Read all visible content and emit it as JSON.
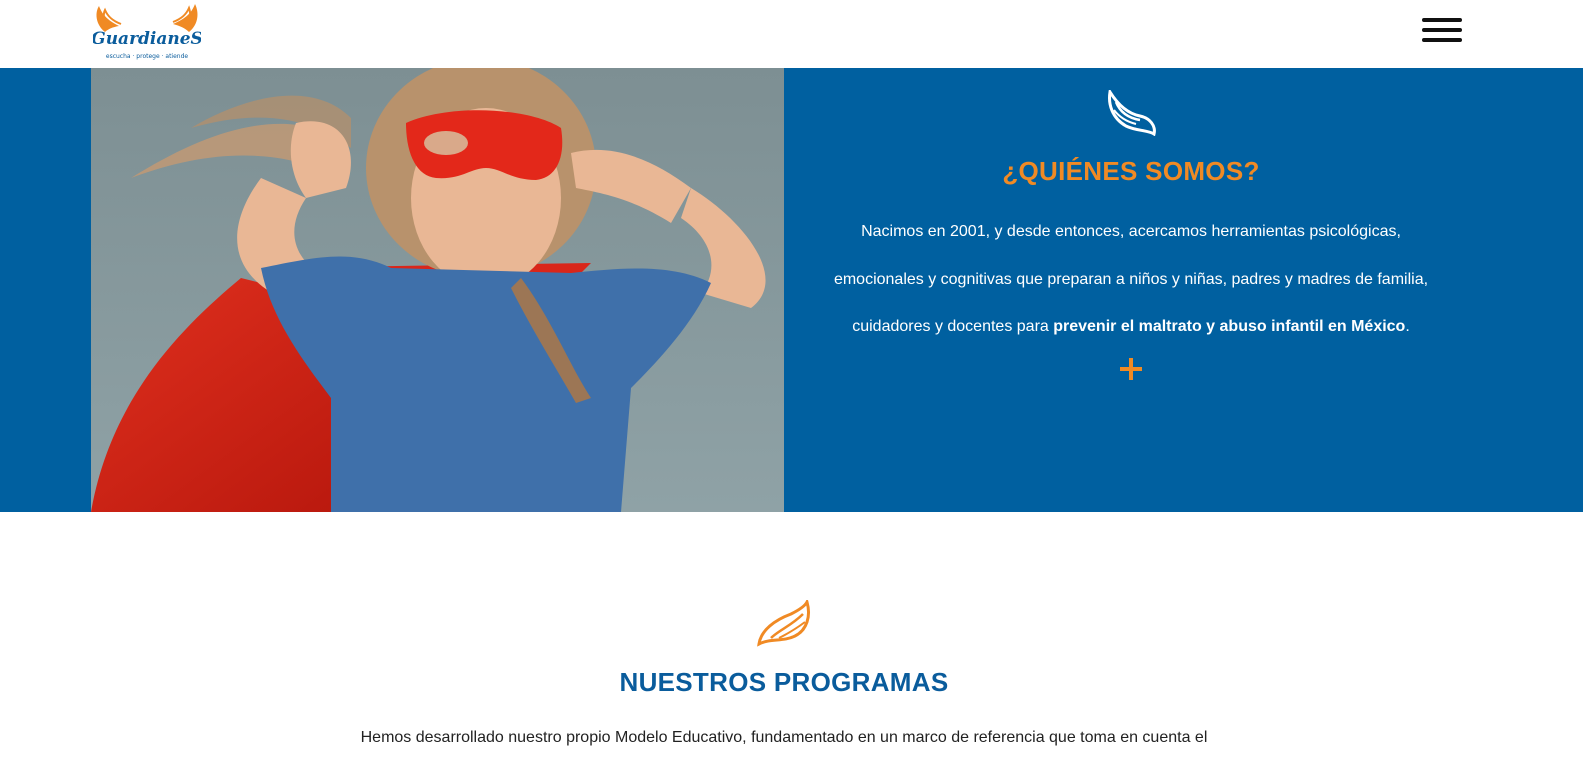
{
  "header": {
    "logo_text": "GuardianeS",
    "logo_tagline": "escucha · protege · atiende",
    "menu_icon": "hamburger-menu-icon"
  },
  "about": {
    "icon": "wing-icon",
    "title": "¿QUIÉNES SOMOS?",
    "text_start": "Nacimos en 2001, y desde entonces, acercamos herramientas psicológicas, emocionales y cognitivas que preparan a niños y niñas, padres y madres de familia, cuidadores y docentes para ",
    "text_bold": "prevenir el maltrato y abuso infantil en México",
    "text_end": ".",
    "more_symbol": "+"
  },
  "programs": {
    "icon": "wing-icon",
    "title": "NUESTROS PROGRAMAS",
    "text": "Hemos desarrollado nuestro propio Modelo Educativo, fundamentado en un marco de referencia que toma en cuenta el"
  },
  "colors": {
    "brand_blue": "#0060a0",
    "title_blue": "#0a5c9c",
    "accent_orange": "#f08a24"
  }
}
